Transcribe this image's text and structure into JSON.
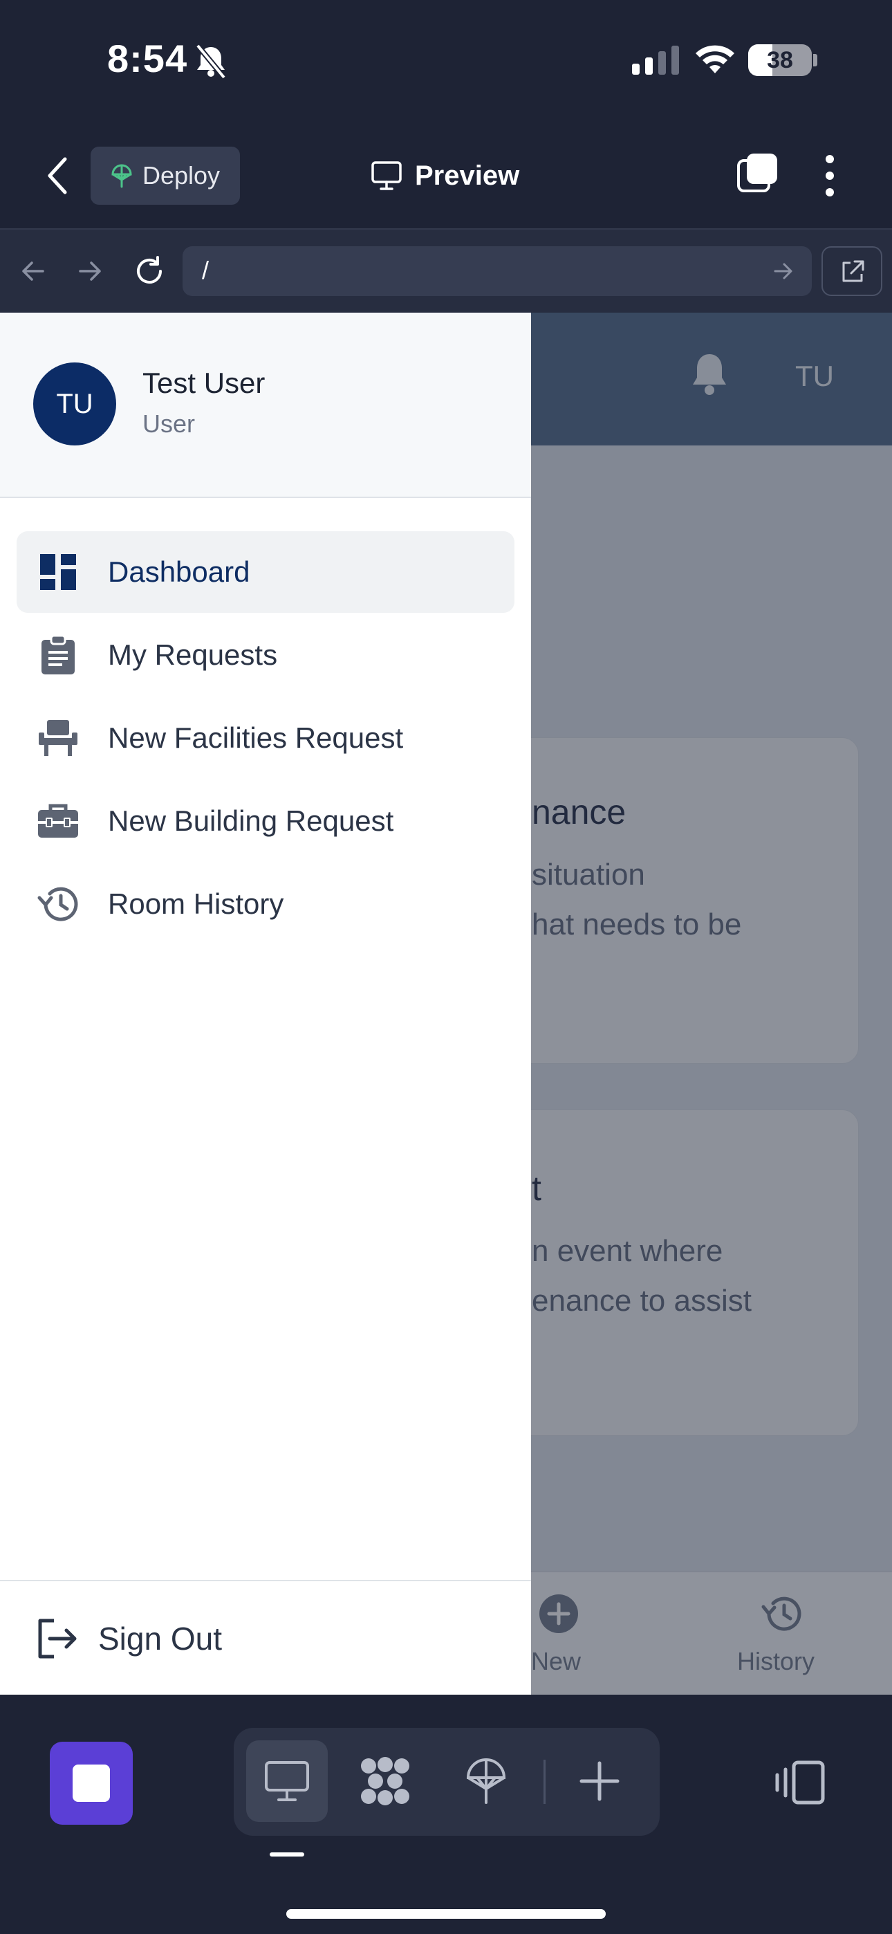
{
  "status_bar": {
    "time": "8:54",
    "battery": "38"
  },
  "header": {
    "deploy_label": "Deploy",
    "preview_label": "Preview"
  },
  "url_bar": {
    "url": "/"
  },
  "app": {
    "header_initials": "TU",
    "cards": [
      {
        "title_fragment": "nance",
        "desc_line1": "situation",
        "desc_line2": "hat needs to be"
      },
      {
        "title_fragment": "t",
        "desc_line1": "n event where",
        "desc_line2": "enance to assist"
      }
    ],
    "bottom_nav": [
      {
        "label": "New"
      },
      {
        "label": "History"
      }
    ]
  },
  "drawer": {
    "user": {
      "initials": "TU",
      "name": "Test User",
      "role": "User"
    },
    "items": [
      {
        "label": "Dashboard",
        "icon": "dashboard-icon",
        "active": true
      },
      {
        "label": "My Requests",
        "icon": "clipboard-icon"
      },
      {
        "label": "New Facilities Request",
        "icon": "chair-icon"
      },
      {
        "label": "New Building Request",
        "icon": "toolbox-icon"
      },
      {
        "label": "Room History",
        "icon": "history-icon"
      }
    ],
    "sign_out": "Sign Out"
  },
  "colors": {
    "accent": "#0c2c66",
    "stop_button": "#5b3fd6",
    "app_header": "#4b6584",
    "deploy_icon": "#4cc38a"
  }
}
